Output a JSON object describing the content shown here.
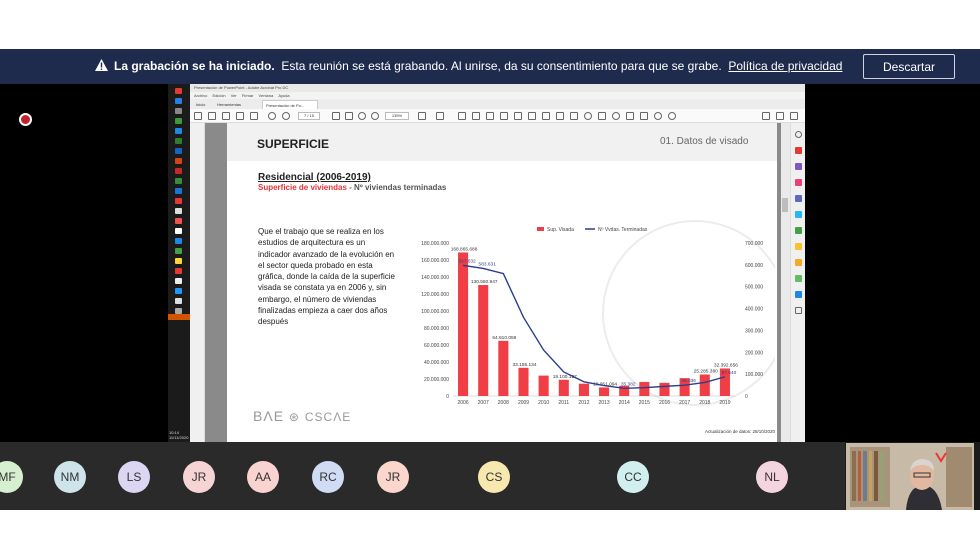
{
  "banner": {
    "title": "La grabación se ha iniciado.",
    "message": "Esta reunión se está grabando. Al unirse, da su consentimiento para que se grabe.",
    "link": "Política de privacidad",
    "dismiss_label": "Descartar"
  },
  "shared_screen": {
    "taskbar": {
      "time": "10:14",
      "date": "11/11/2020"
    },
    "acrobat": {
      "window_title": "Presentación de PowerPoint - Adobe Acrobat Pro DC",
      "menu": [
        "Archivo",
        "Edición",
        "Ver",
        "Firmar",
        "Ventana",
        "Ayuda"
      ],
      "tabs": [
        "Inicio",
        "Herramientas",
        "Presentación de Po..."
      ],
      "page_indicator": "7 / 15",
      "zoom": "135%"
    },
    "slide": {
      "title": "SUPERFICIE",
      "section": "01. Datos de visado",
      "heading": "Residencial (2006-2019)",
      "subheading_red": "Superficie de viviendas",
      "subheading_sep": " - ",
      "subheading_gray": "Nº viviendas terminadas",
      "body": "Que el trabajo que se realiza en los estudios de arquitectura es un indicador avanzado de la evolución en el sector queda probado en esta gráfica, donde la caída de la superficie visada se constata ya en 2006 y, sin embargo, el número de viviendas finalizadas empieza a caer dos años después",
      "logo_left": "BΛE",
      "logo_right": "CSCΛE",
      "update_note": "Actualización de datos: 28/10/2020"
    }
  },
  "chart_data": {
    "type": "bar",
    "categories": [
      "2006",
      "2007",
      "2008",
      "2009",
      "2010",
      "2011",
      "2012",
      "2013",
      "2014",
      "2015",
      "2016",
      "2017",
      "2018",
      "2019"
    ],
    "series": [
      {
        "name": "Sup. Visada",
        "type": "bar",
        "axis": "left",
        "color": "#ef3e45",
        "values": [
          168865688,
          130550947,
          64910059,
          33155134,
          24000000,
          19100127,
          14500000,
          10051094,
          12000000,
          16500000,
          15500000,
          21000000,
          25285380,
          32392656
        ],
        "labels": [
          "168.865.688",
          "130.550.947",
          "64.910.059",
          "33.155.134",
          "",
          "19.100.127",
          "",
          "10.051.094",
          "",
          "",
          "",
          "",
          "25.285.380",
          "32.392.656"
        ]
      },
      {
        "name": "Nº Vvdas. Terminadas",
        "type": "line",
        "axis": "right",
        "color": "#2b3f8c",
        "values": [
          597632,
          583631,
          560000,
          360000,
          210000,
          110000,
          65000,
          48000,
          35382,
          38000,
          44000,
          49336,
          62000,
          87540
        ],
        "labels": [
          "597.632",
          "583.631",
          "",
          "",
          "",
          "",
          "",
          "",
          "35.382",
          "",
          "",
          "49.336",
          "",
          "87.540"
        ]
      }
    ],
    "y_left": {
      "min": 0,
      "max": 180000000,
      "ticks": [
        "0",
        "20.000.000",
        "40.000.000",
        "60.000.000",
        "80.000.000",
        "100.000.000",
        "120.000.000",
        "140.000.000",
        "160.000.000",
        "180.000.000"
      ]
    },
    "y_right": {
      "min": 0,
      "max": 700000,
      "ticks": [
        "0",
        "100.000",
        "200.000",
        "300.000",
        "400.000",
        "500.000",
        "600.000",
        "700.000"
      ]
    },
    "legend_position": "top",
    "grid": false
  },
  "participants": [
    {
      "initials": "MF",
      "color": "#d6efd0"
    },
    {
      "initials": "NM",
      "color": "#cfe3ea"
    },
    {
      "initials": "LS",
      "color": "#dcd6f3"
    },
    {
      "initials": "JR",
      "color": "#f6d4d4"
    },
    {
      "initials": "AA",
      "color": "#f9d3cf"
    },
    {
      "initials": "RC",
      "color": "#cfdcf3"
    },
    {
      "initials": "JR",
      "color": "#fad6cc"
    },
    {
      "initials": "CS",
      "color": "#f7e8b0"
    },
    {
      "initials": "CC",
      "color": "#d2eff0"
    },
    {
      "initials": "NL",
      "color": "#f4d4de"
    }
  ]
}
